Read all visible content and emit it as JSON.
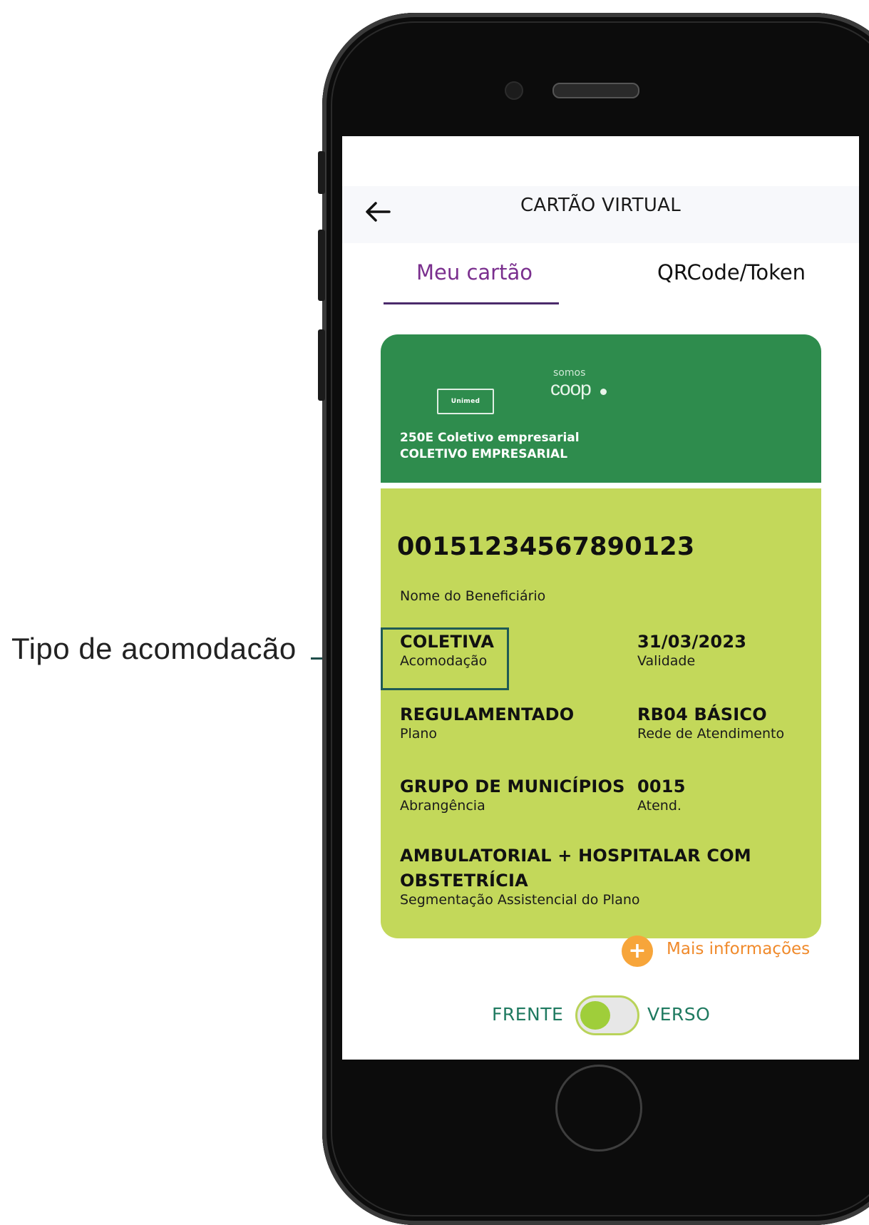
{
  "annotation": {
    "label": "Tipo de acomodacão"
  },
  "header": {
    "title": "CARTÃO VIRTUAL",
    "back_icon": "arrow-left-icon"
  },
  "tabs": [
    {
      "label": "Meu cartão",
      "active": true
    },
    {
      "label": "QRCode/Token",
      "active": false
    }
  ],
  "card": {
    "logo_text": "Unimed",
    "brand_top": "somos",
    "brand_bottom": "coop",
    "plan_code_line": "250E Coletivo empresarial",
    "plan_type_line": "COLETIVO EMPRESARIAL",
    "number": "00151234567890123",
    "beneficiary_name": "Nome do Beneficiário",
    "fields": [
      {
        "value": "COLETIVA",
        "label": "Acomodação"
      },
      {
        "value": "31/03/2023",
        "label": "Validade"
      },
      {
        "value": "REGULAMENTADO",
        "label": "Plano"
      },
      {
        "value": "RB04 BÁSICO",
        "label": "Rede de Atendimento"
      },
      {
        "value": "GRUPO DE MUNICÍPIOS",
        "label": "Abrangência"
      },
      {
        "value": "0015",
        "label": "Atend."
      }
    ],
    "segmentation": {
      "value_line1": "AMBULATORIAL + HOSPITALAR COM",
      "value_line2": "OBSTETRÍCIA",
      "label": "Segmentação Assistencial do Plano"
    }
  },
  "more_info": {
    "label": "Mais informações"
  },
  "side_toggle": {
    "left_label": "FRENTE",
    "right_label": "VERSO",
    "state": "FRENTE"
  },
  "colors": {
    "card_header": "#2e8c4d",
    "card_body": "#c3d85a",
    "tab_active": "#7a2f8e",
    "accent_orange": "#f08a2b",
    "toggle_text": "#1f7a60"
  }
}
